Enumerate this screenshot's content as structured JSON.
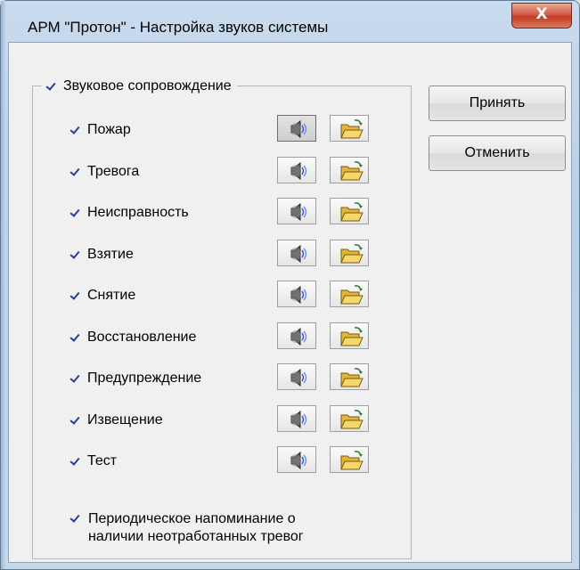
{
  "window": {
    "title": "АРМ \"Протон\" - Настройка звуков системы",
    "close_label": "X"
  },
  "group": {
    "label": "Звуковое сопровождение",
    "checked": true
  },
  "events": [
    {
      "label": "Пожар",
      "checked": true
    },
    {
      "label": "Тревога",
      "checked": true
    },
    {
      "label": "Неисправность",
      "checked": true
    },
    {
      "label": "Взятие",
      "checked": true
    },
    {
      "label": "Снятие",
      "checked": true
    },
    {
      "label": "Восстановление",
      "checked": true
    },
    {
      "label": "Предупреждение",
      "checked": true
    },
    {
      "label": "Извещение",
      "checked": true
    },
    {
      "label": "Тест",
      "checked": true
    }
  ],
  "reminder": {
    "line1": "Периодическое напоминание о",
    "line2": "наличии неотработанных тревог",
    "checked": true
  },
  "buttons": {
    "accept": "Принять",
    "cancel": "Отменить"
  },
  "icons": {
    "play": "speaker-icon",
    "open": "folder-open-icon",
    "check": "checkmark-icon"
  }
}
